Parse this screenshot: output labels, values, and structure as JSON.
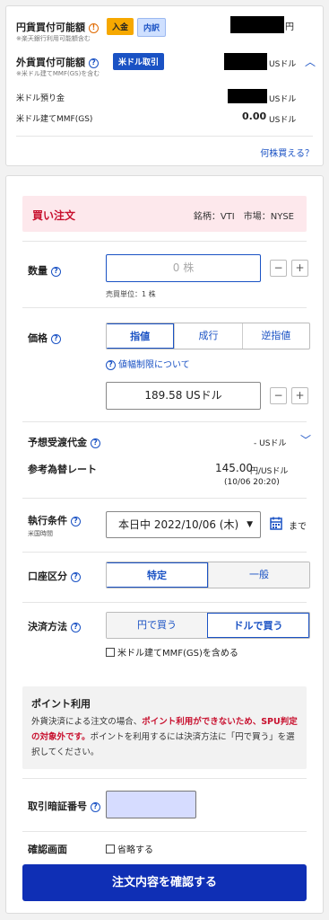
{
  "top": {
    "jpy_label": "円貨買付可能額",
    "jpy_note": "※楽天銀行利用可能額含む",
    "deposit_btn": "入金",
    "detail_btn": "内訳",
    "jpy_unit": "円",
    "usd_label": "外貨買付可能額",
    "usd_note": "※米ドル建てMMF(GS)を含む",
    "usd_trade_btn": "米ドル取引",
    "usd_unit": "USドル",
    "usd_deposit_label": "米ドル預り金",
    "usd_deposit_unit": "USドル",
    "mmf_label": "米ドル建てMMF(GS)",
    "mmf_value": "0.00",
    "mmf_unit": "USドル",
    "how_many_link": "何株買える？"
  },
  "order": {
    "header_title": "買い注文",
    "symbol_info": "銘柄：VTI　市場：NYSE",
    "quantity_label": "数量",
    "quantity_placeholder": "0 株",
    "unit_note": "売買単位：1 株",
    "price_label": "価格",
    "price_types": [
      "指値",
      "成行",
      "逆指値"
    ],
    "price_limit_link": "値幅制限について",
    "price_value": "189.58 USドル",
    "est_label": "予想受渡代金",
    "est_value": "- USドル",
    "rate_label": "参考為替レート",
    "rate_value": "145.00",
    "rate_unit": "円/USドル",
    "rate_time": "(10/06  20:20)",
    "exec_label": "執行条件",
    "exec_sub": "米国時間",
    "exec_value": "本日中 2022/10/06 (木)",
    "exec_until": "まで",
    "account_label": "口座区分",
    "account_options": [
      "特定",
      "一般"
    ],
    "settle_label": "決済方法",
    "settle_options": [
      "円で買う",
      "ドルで買う"
    ],
    "settle_mmf_check": "米ドル建てMMF(GS)を含める",
    "point_title": "ポイント利用",
    "point_text_1": "外貨決済による注文の場合、",
    "point_text_red": "ポイント利用ができないため、SPU判定の対象外です。",
    "point_text_2": "ポイントを利用するには決済方法に「円で買う」を選択してください。",
    "pin_label": "取引暗証番号",
    "confirm_label": "確認画面",
    "confirm_skip": "省略する",
    "submit": "注文内容を確認する"
  },
  "colors": {
    "accent": "#1a52c4",
    "submit_bg": "#0f2fb5",
    "header_bg": "#fde8ec",
    "header_text": "#c8102e",
    "badge_orange": "#f6a800",
    "badge_blue_bg": "#cfe0ff",
    "pin_bg": "#d6dcff"
  }
}
